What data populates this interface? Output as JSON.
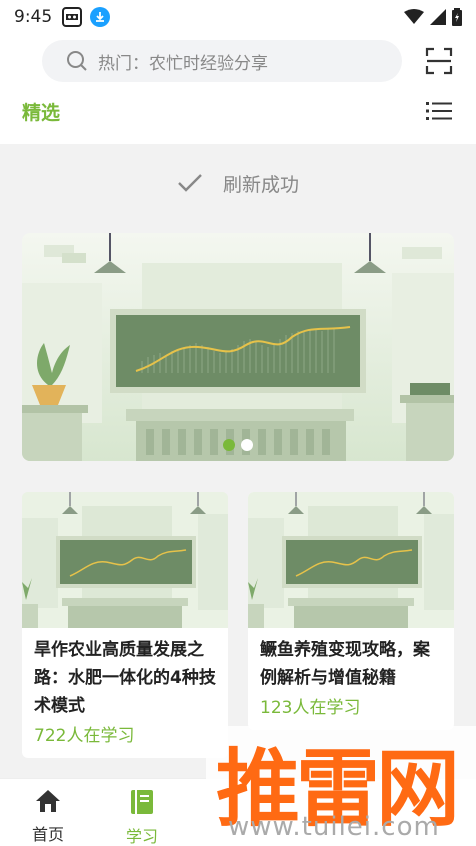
{
  "status_bar": {
    "time": "9:45"
  },
  "search": {
    "placeholder_text": "热门：农忙时经验分享"
  },
  "tabs": {
    "selected": "精选"
  },
  "refresh": {
    "text": "刷新成功"
  },
  "carousel": {
    "page_count": 2,
    "active_index": 0
  },
  "cards": [
    {
      "title": "旱作农业高质量发展之路：水肥一体化的4种技术模式",
      "learners": "722人在学习"
    },
    {
      "title": "鳜鱼养殖变现攻略，案例解析与增值秘籍",
      "learners": "123人在学习"
    }
  ],
  "bottom_nav": [
    {
      "label": "首页",
      "icon": "home-icon"
    },
    {
      "label": "学习",
      "icon": "book-icon"
    }
  ],
  "watermark": {
    "brand": "推雷网",
    "url": "www.tuilei.com"
  },
  "colors": {
    "accent": "#7ab93a",
    "watermark": "#ff6a13"
  }
}
